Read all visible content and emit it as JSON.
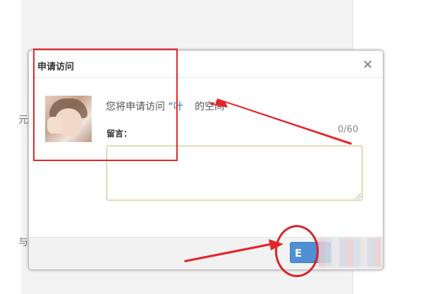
{
  "background": {
    "fragment_top": "元",
    "fragment_bottom": "与"
  },
  "dialog": {
    "title": "申请访问",
    "close_symbol": "×",
    "message_prefix": "您将申请访问 “",
    "owner_name": "叶",
    "message_suffix": " 的空间",
    "leave_message_label": "留言：",
    "char_counter": "0/60",
    "message_value": "",
    "confirm_button_label": "E"
  },
  "colors": {
    "annotation_red": "#e3262c",
    "confirm_blue": "#4f8fd6",
    "textarea_border": "#c9bc7a"
  }
}
